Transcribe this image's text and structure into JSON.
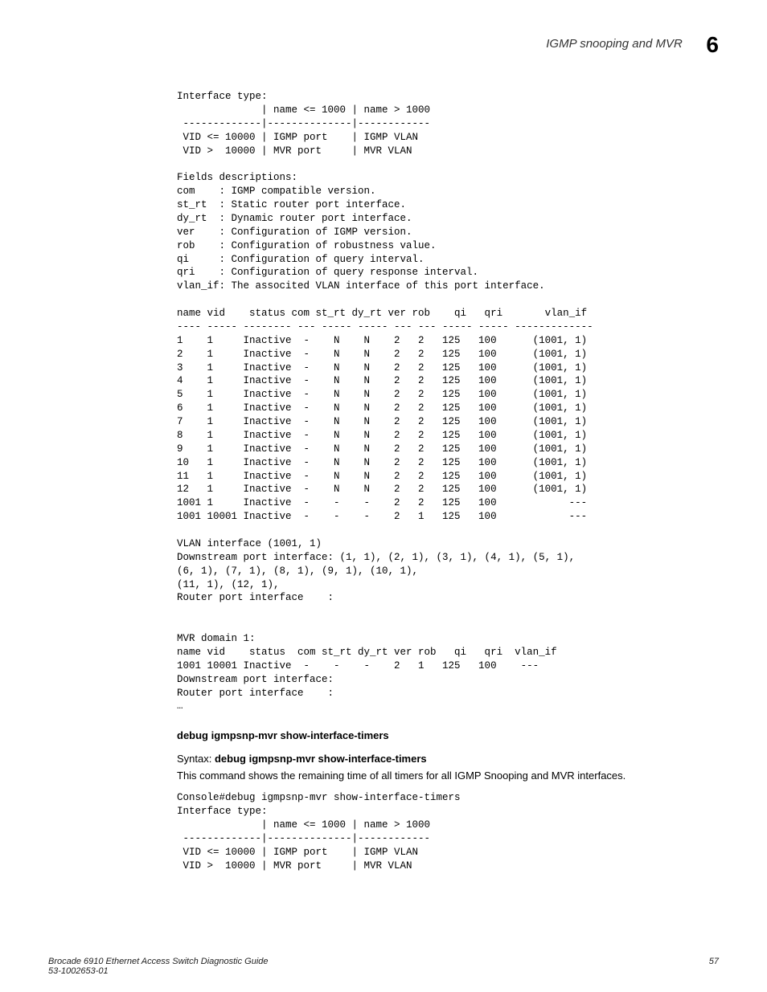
{
  "header": {
    "title": "IGMP snooping and MVR",
    "chapter": "6"
  },
  "block1": "Interface type:\n              | name <= 1000 | name > 1000\n -------------|--------------|------------\n VID <= 10000 | IGMP port    | IGMP VLAN\n VID >  10000 | MVR port     | MVR VLAN\n\nFields descriptions:\ncom    : IGMP compatible version.\nst_rt  : Static router port interface.\ndy_rt  : Dynamic router port interface.\nver    : Configuration of IGMP version.\nrob    : Configuration of robustness value.\nqi     : Configuration of query interval.\nqri    : Configuration of query response interval.\nvlan_if: The associted VLAN interface of this port interface.\n\nname vid    status com st_rt dy_rt ver rob    qi   qri       vlan_if\n---- ----- -------- --- ----- ----- --- --- ----- ----- -------------\n1    1     Inactive  -    N    N    2   2   125   100      (1001, 1)\n2    1     Inactive  -    N    N    2   2   125   100      (1001, 1)\n3    1     Inactive  -    N    N    2   2   125   100      (1001, 1)\n4    1     Inactive  -    N    N    2   2   125   100      (1001, 1)\n5    1     Inactive  -    N    N    2   2   125   100      (1001, 1)\n6    1     Inactive  -    N    N    2   2   125   100      (1001, 1)\n7    1     Inactive  -    N    N    2   2   125   100      (1001, 1)\n8    1     Inactive  -    N    N    2   2   125   100      (1001, 1)\n9    1     Inactive  -    N    N    2   2   125   100      (1001, 1)\n10   1     Inactive  -    N    N    2   2   125   100      (1001, 1)\n11   1     Inactive  -    N    N    2   2   125   100      (1001, 1)\n12   1     Inactive  -    N    N    2   2   125   100      (1001, 1)\n1001 1     Inactive  -    -    -    2   2   125   100            ---\n1001 10001 Inactive  -    -    -    2   1   125   100            ---\n\nVLAN interface (1001, 1)\nDownstream port interface: (1, 1), (2, 1), (3, 1), (4, 1), (5, 1),\n(6, 1), (7, 1), (8, 1), (9, 1), (10, 1),\n(11, 1), (12, 1),\nRouter port interface    :\n\n\nMVR domain 1:\nname vid    status  com st_rt dy_rt ver rob   qi   qri  vlan_if\n1001 10001 Inactive  -    -    -    2   1   125   100    ---\nDownstream port interface:\nRouter port interface    :\n…",
  "section2": {
    "heading": "debug igmpsnp-mvr show-interface-timers",
    "syntax_label": "Syntax:",
    "syntax_cmd": "debug igmpsnp-mvr show-interface-timers",
    "desc": "This command shows the remaining time of all timers for all IGMP Snooping and MVR interfaces.",
    "code": "Console#debug igmpsnp-mvr show-interface-timers\nInterface type:\n              | name <= 1000 | name > 1000\n -------------|--------------|------------\n VID <= 10000 | IGMP port    | IGMP VLAN\n VID >  10000 | MVR port     | MVR VLAN"
  },
  "footer": {
    "line1": "Brocade 6910 Ethernet Access Switch Diagnostic Guide",
    "line2": "53-1002653-01",
    "page": "57"
  },
  "chart_data": {
    "type": "table",
    "title": "IGMP snooping interface configuration",
    "columns": [
      "name",
      "vid",
      "status",
      "com",
      "st_rt",
      "dy_rt",
      "ver",
      "rob",
      "qi",
      "qri",
      "vlan_if"
    ],
    "rows": [
      [
        1,
        1,
        "Inactive",
        "-",
        "N",
        "N",
        2,
        2,
        125,
        100,
        "(1001, 1)"
      ],
      [
        2,
        1,
        "Inactive",
        "-",
        "N",
        "N",
        2,
        2,
        125,
        100,
        "(1001, 1)"
      ],
      [
        3,
        1,
        "Inactive",
        "-",
        "N",
        "N",
        2,
        2,
        125,
        100,
        "(1001, 1)"
      ],
      [
        4,
        1,
        "Inactive",
        "-",
        "N",
        "N",
        2,
        2,
        125,
        100,
        "(1001, 1)"
      ],
      [
        5,
        1,
        "Inactive",
        "-",
        "N",
        "N",
        2,
        2,
        125,
        100,
        "(1001, 1)"
      ],
      [
        6,
        1,
        "Inactive",
        "-",
        "N",
        "N",
        2,
        2,
        125,
        100,
        "(1001, 1)"
      ],
      [
        7,
        1,
        "Inactive",
        "-",
        "N",
        "N",
        2,
        2,
        125,
        100,
        "(1001, 1)"
      ],
      [
        8,
        1,
        "Inactive",
        "-",
        "N",
        "N",
        2,
        2,
        125,
        100,
        "(1001, 1)"
      ],
      [
        9,
        1,
        "Inactive",
        "-",
        "N",
        "N",
        2,
        2,
        125,
        100,
        "(1001, 1)"
      ],
      [
        10,
        1,
        "Inactive",
        "-",
        "N",
        "N",
        2,
        2,
        125,
        100,
        "(1001, 1)"
      ],
      [
        11,
        1,
        "Inactive",
        "-",
        "N",
        "N",
        2,
        2,
        125,
        100,
        "(1001, 1)"
      ],
      [
        12,
        1,
        "Inactive",
        "-",
        "N",
        "N",
        2,
        2,
        125,
        100,
        "(1001, 1)"
      ],
      [
        1001,
        1,
        "Inactive",
        "-",
        "-",
        "-",
        2,
        2,
        125,
        100,
        "---"
      ],
      [
        1001,
        10001,
        "Inactive",
        "-",
        "-",
        "-",
        2,
        1,
        125,
        100,
        "---"
      ]
    ],
    "mvr_domain_1": {
      "columns": [
        "name",
        "vid",
        "status",
        "com",
        "st_rt",
        "dy_rt",
        "ver",
        "rob",
        "qi",
        "qri",
        "vlan_if"
      ],
      "rows": [
        [
          1001,
          10001,
          "Inactive",
          "-",
          "-",
          "-",
          2,
          1,
          125,
          100,
          "---"
        ]
      ]
    },
    "interface_type_matrix": {
      "columns": [
        "",
        "name <= 1000",
        "name > 1000"
      ],
      "rows": [
        [
          "VID <= 10000",
          "IGMP port",
          "IGMP VLAN"
        ],
        [
          "VID >  10000",
          "MVR port",
          "MVR VLAN"
        ]
      ]
    }
  }
}
